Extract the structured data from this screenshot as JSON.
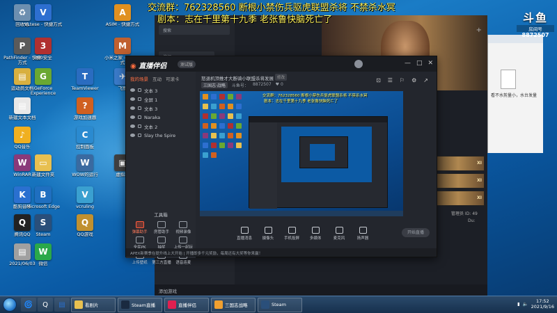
{
  "overlay": {
    "line1": "交流群：762328560 断根小禁伤兵驱虎联盟杀将 不禁杀水冥",
    "line2": "剧本：志在千里第十九季 老张鲁快脑死亡了"
  },
  "room": {
    "logo": "斗鱼",
    "label": "房间号",
    "number": "8872507"
  },
  "desktop_icons": [
    {
      "label": "回收站",
      "color": "#6d8fb0",
      "glyph": "♻"
    },
    {
      "label": "VLtese - 快捷方式",
      "color": "#2d6fd0",
      "glyph": "V"
    },
    {
      "label": "ASIM - 快捷方式",
      "color": "#e09020",
      "glyph": "A"
    },
    {
      "label": "PathFinder - 快捷方式",
      "color": "#5a5a5a",
      "glyph": "P"
    },
    {
      "label": "360安全",
      "color": "#b03030",
      "glyph": "3"
    },
    {
      "label": "小米之家 - 快捷方式",
      "color": "#c06030",
      "glyph": "M"
    },
    {
      "label": "运动员文档",
      "color": "#d8b040",
      "glyph": "▤"
    },
    {
      "label": "GeForce Experience",
      "color": "#6aa832",
      "glyph": "G"
    },
    {
      "label": "TeamViewer",
      "color": "#2a6cc0",
      "glyph": "T"
    },
    {
      "label": "飞鹭",
      "color": "#3a7ac8",
      "glyph": "✈"
    },
    {
      "label": "新建文本文档",
      "color": "#e8e8e8",
      "glyph": "▤"
    },
    {
      "label": "游戏加速器",
      "color": "#d06020",
      "glyph": "?"
    },
    {
      "label": "QQ音乐",
      "color": "#f0b020",
      "glyph": "♪"
    },
    {
      "label": "控制面板",
      "color": "#2a8ad0",
      "glyph": "C"
    },
    {
      "label": "WinRAR",
      "color": "#8a3a7a",
      "glyph": "W"
    },
    {
      "label": "新建文件夹",
      "color": "#e8c050",
      "glyph": "▭"
    },
    {
      "label": "WOW的运行",
      "color": "#3a6aa0",
      "glyph": "W"
    },
    {
      "label": "虚拟机",
      "color": "#404040",
      "glyph": "▣"
    },
    {
      "label": "酷狗音乐",
      "color": "#2a70d0",
      "glyph": "K"
    },
    {
      "label": "Microsoft Edge",
      "color": "#1f6fc0",
      "glyph": "B"
    },
    {
      "label": "vcruling",
      "color": "#3aa0d0",
      "glyph": "V"
    },
    {
      "label": "腾讯QQ",
      "color": "#222",
      "glyph": "Q"
    },
    {
      "label": "Steam",
      "color": "#2a4f7a",
      "glyph": "S"
    },
    {
      "label": "QQ游戏",
      "color": "#c09030",
      "glyph": "Q"
    },
    {
      "label": "2021/06/03",
      "color": "#a0a0a0",
      "glyph": "▤"
    },
    {
      "label": "微信",
      "color": "#2aa84a",
      "glyph": "W"
    }
  ],
  "bg_app": {
    "search_placeholder": "搜索",
    "search2_placeholder": "搜娱",
    "plus": "+",
    "bottom_label": "添加游戏",
    "viewers": "管理员 ID: 49",
    "viewers2": "Du:",
    "lowbar": "TOO GAMES 实时弹幕  ● 打开直播工具    ● 全部分类"
  },
  "right_window": {
    "text": "看不水剪量小，水台发量"
  },
  "main_window": {
    "logo": "直播伴侣",
    "version": "测试版",
    "controls": [
      "—",
      "□",
      "✕"
    ],
    "tabs": [
      "我的场景",
      "互动",
      "可滚卡"
    ],
    "scenes": [
      "文本 3",
      "全屏 1",
      "文本 3",
      "Naraka",
      "文本 2",
      "Slay the Spire"
    ],
    "tools_title": "工具箱",
    "tools": [
      {
        "label": "弹幕助手",
        "hot": true
      },
      {
        "label": "房管助手",
        "hot": false
      },
      {
        "label": "视频录像",
        "hot": false
      },
      {
        "label": "全民PK",
        "hot": false
      },
      {
        "label": "抽奖",
        "hot": false
      },
      {
        "label": "上传一起玩",
        "hot": false
      },
      {
        "label": "上传壁纸",
        "hot": false
      },
      {
        "label": "第三方直播",
        "hot": false
      },
      {
        "label": "语音连麦",
        "hot": false
      }
    ],
    "stream_title": "怒退机顶推才大断骑小联盟杀将发展",
    "stream_badge": "修改",
    "stream_cat": "三国志·战略",
    "stream_room": "斗鱼号：",
    "stream_room_num": "8872507",
    "stream_like": "♥ 0",
    "head_icons": [
      "⊡",
      "☰",
      "⚐",
      "⚙",
      "↗"
    ],
    "preview_line1": "交流群：762328560 断根小禁伤兵驱虎联盟杀将 不禁杀水冥",
    "preview_line2": "剧本：志在千里第十九季 老张鲁快脑死亡了",
    "bottom_tools": [
      "直播消息",
      "摄像头",
      "手机投屏",
      "多媒体",
      "麦克风",
      "扬声器"
    ],
    "start_label": "开始直播",
    "status": "APEX新赛季在提升线上大开始 | 开播即多千元奖励，每周还有大奖等你来赢！"
  },
  "taskbar": {
    "pins": [
      {
        "glyph": "🌀",
        "color": "#f0c040"
      },
      {
        "glyph": "Q",
        "color": "#222"
      },
      {
        "glyph": "▤",
        "color": "#2a70d0"
      }
    ],
    "tasks": [
      {
        "label": "看剧片",
        "color": "#e8c050"
      },
      {
        "label": "Steam直播",
        "color": "#1a2a40"
      },
      {
        "label": "直播伴侣",
        "color": "#e02050"
      },
      {
        "label": "三国志战略",
        "color": "#f0a030"
      },
      {
        "label": "Steam",
        "color": "#2a4f7a"
      }
    ],
    "time": "17:52",
    "date": "2021/9/16"
  }
}
